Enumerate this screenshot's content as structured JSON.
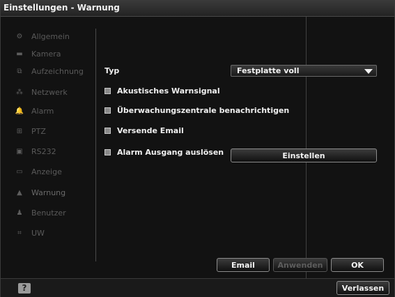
{
  "window": {
    "title": "Einstellungen - Warnung"
  },
  "sidebar": {
    "items": [
      {
        "label": "Allgemein",
        "icon": "⚙"
      },
      {
        "label": "Kamera",
        "icon": "▬"
      },
      {
        "label": "Aufzeichnung",
        "icon": "⧉"
      },
      {
        "label": "Netzwerk",
        "icon": "⁂"
      },
      {
        "label": "Alarm",
        "icon": "🔔"
      },
      {
        "label": "PTZ",
        "icon": "⊞"
      },
      {
        "label": "RS232",
        "icon": "▣"
      },
      {
        "label": "Anzeige",
        "icon": "▭"
      },
      {
        "label": "Warnung",
        "icon": "▲"
      },
      {
        "label": "Benutzer",
        "icon": "♟"
      },
      {
        "label": "UW",
        "icon": "⌗"
      }
    ],
    "active": "Warnung"
  },
  "form": {
    "type_label": "Typ",
    "type_value": "Festplatte voll",
    "options": [
      {
        "label": "Akustisches Warnsignal",
        "checked": true
      },
      {
        "label": "Überwachungszentrale benachrichtigen",
        "checked": true
      },
      {
        "label": "Versende Email",
        "checked": true
      },
      {
        "label": "Alarm Ausgang auslösen",
        "checked": true
      }
    ],
    "settings_button": "Einstellen"
  },
  "actions": {
    "email": "Email",
    "apply": "Anwenden",
    "ok": "OK"
  },
  "footer": {
    "help_icon": "help-icon",
    "help_glyph": "?",
    "exit": "Verlassen"
  },
  "colors": {
    "text": "#f0f0f0",
    "disabled": "#5d5d5d",
    "background": "#121212"
  }
}
